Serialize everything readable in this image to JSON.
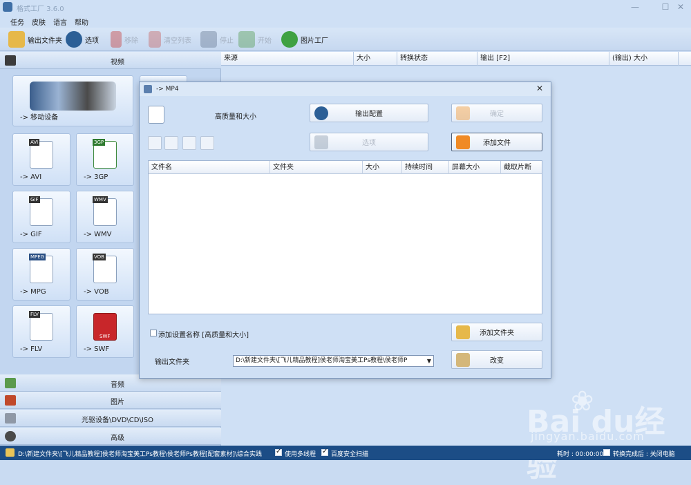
{
  "window": {
    "title": "格式工厂 3.6.0",
    "min": "—",
    "max": "☐",
    "close": "✕"
  },
  "menu": [
    "任务",
    "皮肤",
    "语言",
    "帮助"
  ],
  "toolbar": {
    "output_folder": "输出文件夹",
    "options": "选项",
    "remove": "移除",
    "clear_list": "清空列表",
    "stop": "停止",
    "start": "开始",
    "picture_factory": "图片工厂"
  },
  "left": {
    "video": "视频",
    "mobile": "-> 移动设备",
    "formats": [
      {
        "label": "-> AVI",
        "tag": "AVI"
      },
      {
        "label": "-> 3GP",
        "tag": "3GP"
      },
      {
        "label": "-> GIF",
        "tag": "GIF"
      },
      {
        "label": "-> WMV",
        "tag": "WMV"
      },
      {
        "label": "-> MPG",
        "tag": "MPEG"
      },
      {
        "label": "-> VOB",
        "tag": "VOB"
      },
      {
        "label": "-> FLV",
        "tag": "FLV"
      },
      {
        "label": "-> SWF",
        "tag": "SWF"
      }
    ],
    "audio": "音频",
    "picture": "图片",
    "rom": "光驱设备\\DVD\\CD\\ISO",
    "advanced": "高级"
  },
  "file_table": {
    "columns": [
      "来源",
      "大小",
      "转换状态",
      "输出 [F2]",
      "(输出) 大小"
    ]
  },
  "dialog": {
    "title": "-> MP4",
    "quality": "高质量和大小",
    "output_config": "输出配置",
    "ok": "确定",
    "options": "选项",
    "add_file": "添加文件",
    "columns": [
      "文件名",
      "文件夹",
      "大小",
      "持续时间",
      "屏幕大小",
      "截取片断"
    ],
    "add_setting_name": "添加设置名称 [高质量和大小]",
    "add_folder": "添加文件夹",
    "output_folder_label": "输出文件夹",
    "output_path": "D:\\新建文件夹\\[飞儿精品教程]侯老师淘宝美工Ps教程\\侯老师P",
    "change": "改变"
  },
  "status": {
    "path": "D:\\新建文件夹\\[飞儿精品教程]侯老师淘宝美工Ps教程\\侯老师Ps教程[配套素材]\\综合实践",
    "multithread": "使用多线程",
    "baidu_scan": "百度安全扫描",
    "elapsed": "耗时 : 00:00:00",
    "after_convert": "转换完成后 : 关闭电脑"
  },
  "watermark": {
    "logo": "Bai  du经验",
    "url": "jingyan.baidu.com"
  }
}
